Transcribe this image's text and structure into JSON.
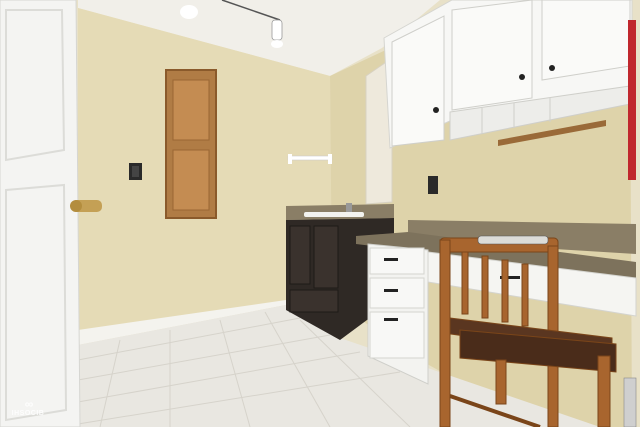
{
  "photo": {
    "watermark": {
      "logo": "∞",
      "text": "IHSOCIB"
    },
    "colors": {
      "wall": "#e6dcb8",
      "ceiling": "#f1efe9",
      "door": "#f4f4f2",
      "cabinet_white": "#f7f7f5",
      "vanity": "#2f2925",
      "countertop": "#8a7e66",
      "floor": "#e9e7e1",
      "chair_wood": "#a8652e",
      "access_panel": "#b07c45"
    }
  }
}
